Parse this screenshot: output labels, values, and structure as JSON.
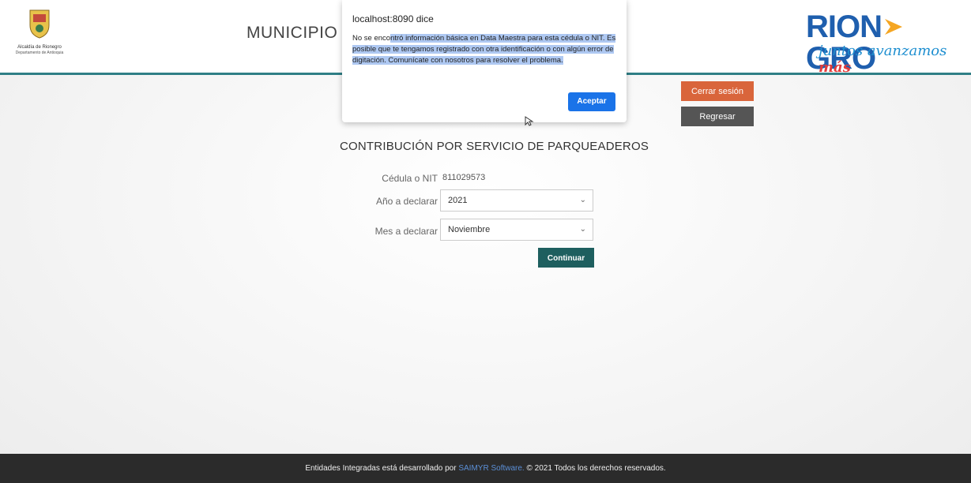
{
  "header": {
    "logo_caption": "Alcaldía de Rionegro",
    "logo_subcaption": "Departamento de Antioquia",
    "municipio_title": "MUNICIPIO D",
    "brand_name": "RIONEGRO",
    "brand_name_part1": "RION",
    "brand_name_part2": "GRO",
    "brand_tagline": "juntos avanzamos",
    "brand_tagline_emph": "más"
  },
  "actions": {
    "logout_label": "Cerrar sesión",
    "back_label": "Regresar"
  },
  "form": {
    "title": "CONTRIBUCIÓN POR SERVICIO DE PARQUEADEROS",
    "nit_label": "Cédula o NIT",
    "nit_value": "811029573",
    "year_label": "Año a declarar",
    "year_value": "2021",
    "month_label": "Mes a declarar",
    "month_value": "Noviembre",
    "continue_label": "Continuar"
  },
  "dialog": {
    "title": "localhost:8090 dice",
    "message_plain": "No se enco",
    "message_highlighted": "ntró información básica en Data Maestra para esta cédula o NIT. Es posible que te tengamos registrado con otra identificación o con algún error de digitación. Comunícate con nosotros para resolver el problema.",
    "accept_label": "Aceptar"
  },
  "footer": {
    "text_before": "Entidades Integradas está desarrollado por",
    "link_text": "SAIMYR Software.",
    "text_after": "© 2021 Todos los derechos reservados."
  },
  "colors": {
    "accent_teal": "#2f7f86",
    "logout_orange": "#d9653b",
    "brand_blue": "#1f5fae",
    "dialog_button_blue": "#1a73e8"
  }
}
